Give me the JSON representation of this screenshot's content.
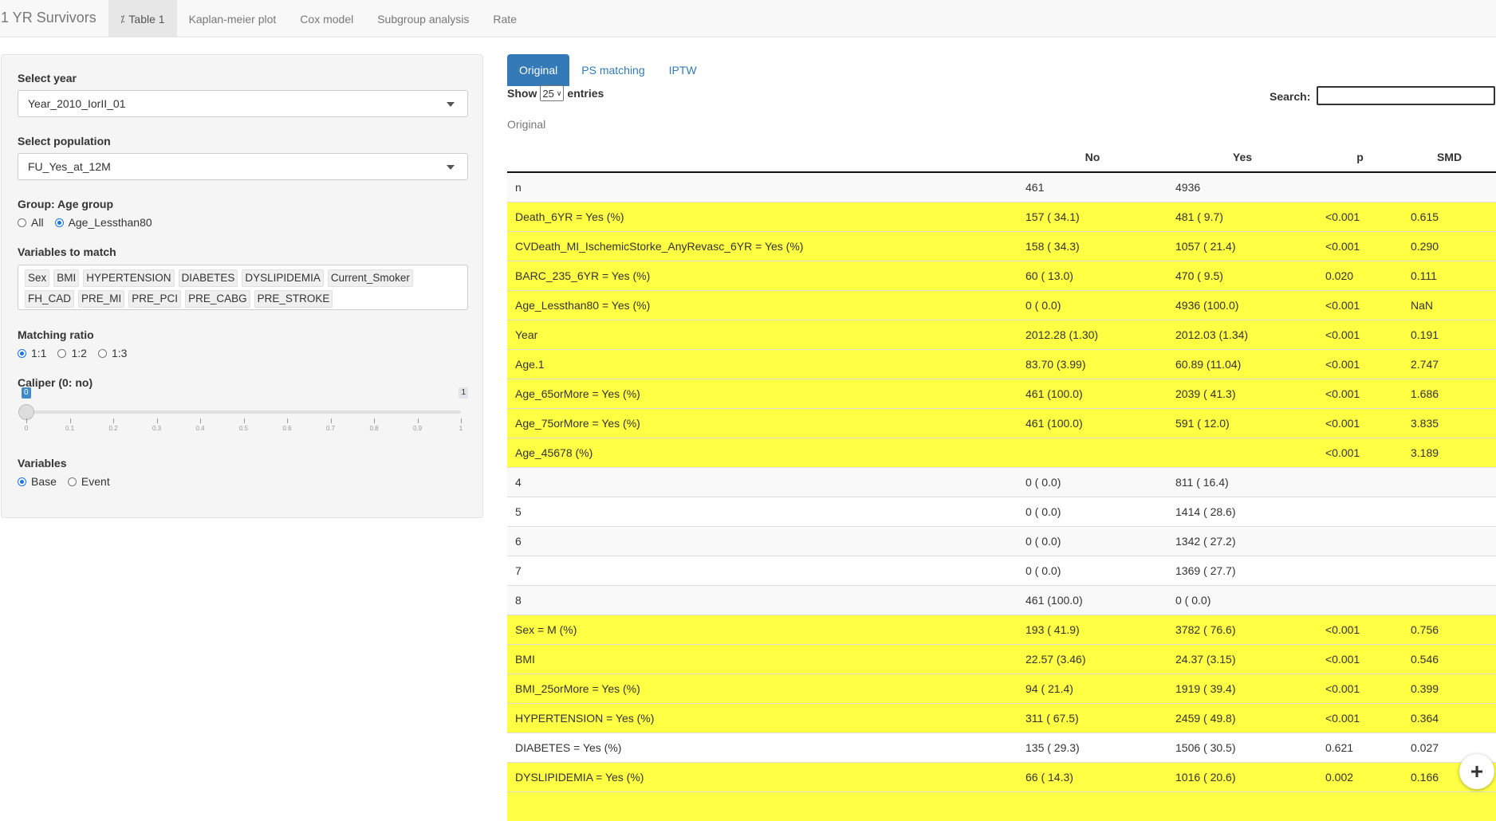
{
  "navbar": {
    "brand": "1 YR Survivors",
    "tabs": [
      {
        "label": "Table 1",
        "icon": "percent-icon",
        "active": true
      },
      {
        "label": "Kaplan-meier plot"
      },
      {
        "label": "Cox model"
      },
      {
        "label": "Subgroup analysis"
      },
      {
        "label": "Rate"
      }
    ]
  },
  "sidebar": {
    "year_label": "Select year",
    "year_value": "Year_2010_IorII_01",
    "population_label": "Select population",
    "population_value": "FU_Yes_at_12M",
    "group_label": "Group: Age group",
    "group_options": [
      "All",
      "Age_Lessthan80"
    ],
    "group_selected": "Age_Lessthan80",
    "match_label": "Variables to match",
    "match_tags": [
      "Sex",
      "BMI",
      "HYPERTENSION",
      "DIABETES",
      "DYSLIPIDEMIA",
      "Current_Smoker",
      "FH_CAD",
      "PRE_MI",
      "PRE_PCI",
      "PRE_CABG",
      "PRE_STROKE"
    ],
    "ratio_label": "Matching ratio",
    "ratio_options": [
      "1:1",
      "1:2",
      "1:3"
    ],
    "ratio_selected": "1:1",
    "caliper_label": "Caliper (0: no)",
    "caliper": {
      "min": "0",
      "max": "1",
      "value": 0,
      "ticks": [
        "0",
        "0.1",
        "0.2",
        "0.3",
        "0.4",
        "0.5",
        "0.6",
        "0.7",
        "0.8",
        "0.9",
        "1"
      ]
    },
    "variables_label": "Variables",
    "variables_options": [
      "Base",
      "Event"
    ],
    "variables_selected": "Base"
  },
  "main": {
    "subtabs": [
      "Original",
      "PS matching",
      "IPTW"
    ],
    "show_label": "Show",
    "entries_value": "25",
    "entries_label": "entries",
    "search_label": "Search:",
    "caption": "Original",
    "columns": [
      "",
      "No",
      "Yes",
      "p",
      "SMD"
    ],
    "rows": [
      {
        "cells": [
          "n",
          "461",
          "4936",
          "",
          ""
        ],
        "hl": false
      },
      {
        "cells": [
          "Death_6YR = Yes (%)",
          "157 ( 34.1)",
          "481 ( 9.7)",
          "<0.001",
          "0.615"
        ],
        "hl": true
      },
      {
        "cells": [
          "CVDeath_MI_IschemicStorke_AnyRevasc_6YR = Yes (%)",
          "158 ( 34.3)",
          "1057 ( 21.4)",
          "<0.001",
          "0.290"
        ],
        "hl": true
      },
      {
        "cells": [
          "BARC_235_6YR = Yes (%)",
          "60 ( 13.0)",
          "470 ( 9.5)",
          "0.020",
          "0.111"
        ],
        "hl": true
      },
      {
        "cells": [
          "Age_Lessthan80 = Yes (%)",
          "0 ( 0.0)",
          "4936 (100.0)",
          "<0.001",
          "NaN"
        ],
        "hl": true
      },
      {
        "cells": [
          "Year",
          "2012.28 (1.30)",
          "2012.03 (1.34)",
          "<0.001",
          "0.191"
        ],
        "hl": true
      },
      {
        "cells": [
          "Age.1",
          "83.70 (3.99)",
          "60.89 (11.04)",
          "<0.001",
          "2.747"
        ],
        "hl": true
      },
      {
        "cells": [
          "Age_65orMore = Yes (%)",
          "461 (100.0)",
          "2039 ( 41.3)",
          "<0.001",
          "1.686"
        ],
        "hl": true
      },
      {
        "cells": [
          "Age_75orMore = Yes (%)",
          "461 (100.0)",
          "591 ( 12.0)",
          "<0.001",
          "3.835"
        ],
        "hl": true
      },
      {
        "cells": [
          "Age_45678 (%)",
          "",
          "",
          "<0.001",
          "3.189"
        ],
        "hl": true
      },
      {
        "cells": [
          "4",
          "0 ( 0.0)",
          "811 ( 16.4)",
          "",
          ""
        ],
        "hl": false
      },
      {
        "cells": [
          "5",
          "0 ( 0.0)",
          "1414 ( 28.6)",
          "",
          ""
        ],
        "hl": false
      },
      {
        "cells": [
          "6",
          "0 ( 0.0)",
          "1342 ( 27.2)",
          "",
          ""
        ],
        "hl": false
      },
      {
        "cells": [
          "7",
          "0 ( 0.0)",
          "1369 ( 27.7)",
          "",
          ""
        ],
        "hl": false
      },
      {
        "cells": [
          "8",
          "461 (100.0)",
          "0 ( 0.0)",
          "",
          ""
        ],
        "hl": false
      },
      {
        "cells": [
          "Sex = M (%)",
          "193 ( 41.9)",
          "3782 ( 76.6)",
          "<0.001",
          "0.756"
        ],
        "hl": true
      },
      {
        "cells": [
          "BMI",
          "22.57 (3.46)",
          "24.37 (3.15)",
          "<0.001",
          "0.546"
        ],
        "hl": true
      },
      {
        "cells": [
          "BMI_25orMore = Yes (%)",
          "94 ( 21.4)",
          "1919 ( 39.4)",
          "<0.001",
          "0.399"
        ],
        "hl": true
      },
      {
        "cells": [
          "HYPERTENSION = Yes (%)",
          "311 ( 67.5)",
          "2459 ( 49.8)",
          "<0.001",
          "0.364"
        ],
        "hl": true
      },
      {
        "cells": [
          "DIABETES = Yes (%)",
          "135 ( 29.3)",
          "1506 ( 30.5)",
          "0.621",
          "0.027"
        ],
        "hl": false
      },
      {
        "cells": [
          "DYSLIPIDEMIA = Yes (%)",
          "66 ( 14.3)",
          "1016 ( 20.6)",
          "0.002",
          "0.166"
        ],
        "hl": true
      },
      {
        "cells": [
          "",
          "",
          "",
          "",
          ""
        ],
        "hl": true
      }
    ],
    "fab_label": "+"
  },
  "colors": {
    "highlight": "#ffff44",
    "accent": "#337ab7"
  }
}
